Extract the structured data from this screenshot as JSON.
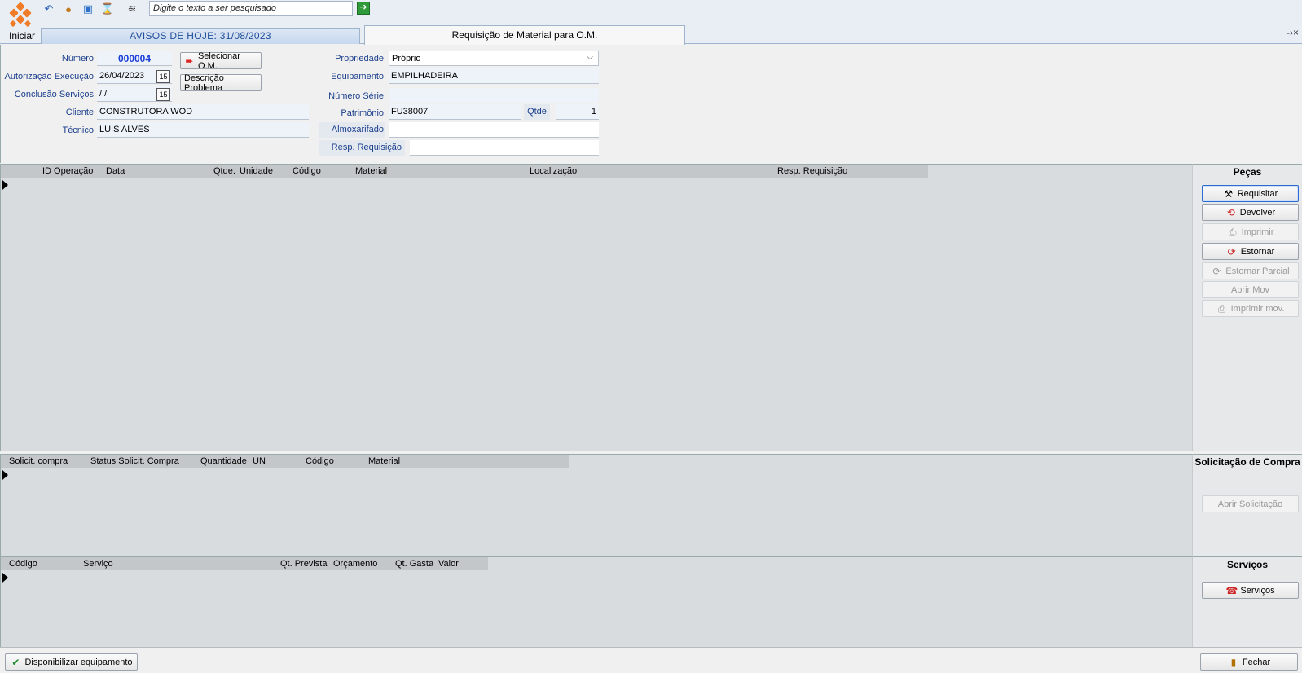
{
  "toolbar": {
    "start_label": "Iniciar",
    "search_placeholder": "Digite o texto a ser pesquisado",
    "go_glyph": "➔"
  },
  "tabs": {
    "news": "AVISOS DE HOJE: 31/08/2023",
    "active": "Requisição de Material para O.M.",
    "close_glyph": "-›×"
  },
  "form": {
    "numero_label": "Número",
    "numero_value": "000004",
    "autorizacao_label": "Autorização Execução",
    "autorizacao_value": "26/04/2023",
    "conclusao_label": "Conclusão Serviços",
    "conclusao_value": " /  /",
    "cliente_label": "Cliente",
    "cliente_value": "CONSTRUTORA WOD",
    "tecnico_label": "Técnico",
    "tecnico_value": "LUIS ALVES",
    "selecionar_btn": "Selecionar O.M.",
    "descricao_btn": "Descrição Problema",
    "propriedade_label": "Propriedade",
    "propriedade_value": "Próprio",
    "equipamento_label": "Equipamento",
    "equipamento_value": "EMPILHADEIRA",
    "numero_serie_label": "Número Série",
    "numero_serie_value": "",
    "patrimonio_label": "Patrimônio",
    "patrimonio_value": "FU38007",
    "qtde_label": "Qtde",
    "qtde_value": "1",
    "almoxarifado_label": "Almoxarifado",
    "almoxarifado_value": "",
    "resp_label": "Resp. Requisição",
    "resp_value": ""
  },
  "pecas": {
    "columns": [
      "ID Operação",
      "Data",
      "Qtde.",
      "Unidade",
      "Código",
      "Material",
      "Localização",
      "Resp. Requisição"
    ],
    "title": "Peças",
    "buttons": [
      "Requisitar",
      "Devolver",
      "Imprimir",
      "Estornar",
      "Estornar Parcial",
      "Abrir Mov",
      "Imprimir mov."
    ]
  },
  "compras": {
    "columns": [
      "Solicit. compra",
      "Status Solicit. Compra",
      "Quantidade",
      "UN",
      "Código",
      "Material"
    ],
    "title": "Solicitação de Compra",
    "button": "Abrir Solicitação"
  },
  "servicos": {
    "columns": [
      "Código",
      "Serviço",
      "Qt. Prevista",
      "Orçamento",
      "Qt. Gasta",
      "Valor"
    ],
    "title": "Serviços",
    "button": "Serviços"
  },
  "footer": {
    "disponibilizar": "Disponibilizar equipamento",
    "fechar": "Fechar"
  }
}
